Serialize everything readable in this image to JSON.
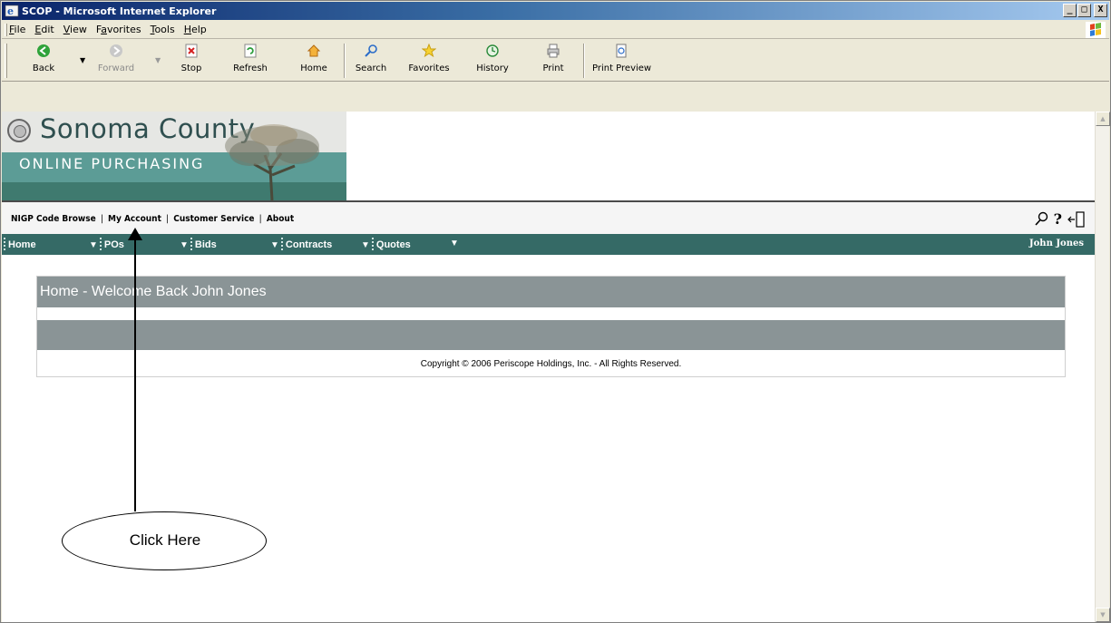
{
  "window": {
    "title": "SCOP - Microsoft Internet Explorer",
    "controls": [
      "_",
      "□",
      "X"
    ]
  },
  "menubar": {
    "items": [
      {
        "label": "File",
        "ul": "F",
        "rest": "ile"
      },
      {
        "label": "Edit",
        "ul": "E",
        "rest": "dit"
      },
      {
        "label": "View",
        "ul": "V",
        "rest": "iew"
      },
      {
        "label": "Favorites",
        "ul": "a",
        "pre": "F",
        "rest": "vorites"
      },
      {
        "label": "Tools",
        "ul": "T",
        "rest": "ools"
      },
      {
        "label": "Help",
        "ul": "H",
        "rest": "elp"
      }
    ]
  },
  "toolbar": {
    "back": "Back",
    "forward": "Forward",
    "stop": "Stop",
    "refresh": "Refresh",
    "home": "Home",
    "search": "Search",
    "favorites": "Favorites",
    "history": "History",
    "print": "Print",
    "print_preview": "Print Preview"
  },
  "banner": {
    "county": "Sonoma County",
    "subtitle": "ONLINE PURCHASING"
  },
  "linkbar": {
    "nigp": "NIGP Code Browse",
    "account": "My Account",
    "service": "Customer Service",
    "about": "About",
    "sep": "|"
  },
  "nav": {
    "home": "Home",
    "pos": "POs",
    "bids": "Bids",
    "contracts": "Contracts",
    "quotes": "Quotes",
    "user": "John Jones"
  },
  "main": {
    "heading": "Home - Welcome Back John Jones",
    "copyright": "Copyright © 2006 Periscope Holdings, Inc. - All Rights Reserved."
  },
  "annotation": {
    "callout": "Click Here"
  },
  "colors": {
    "nav_bg": "#356a66",
    "banner_teal": "#5c9c96",
    "panel_header": "#8a9496"
  }
}
